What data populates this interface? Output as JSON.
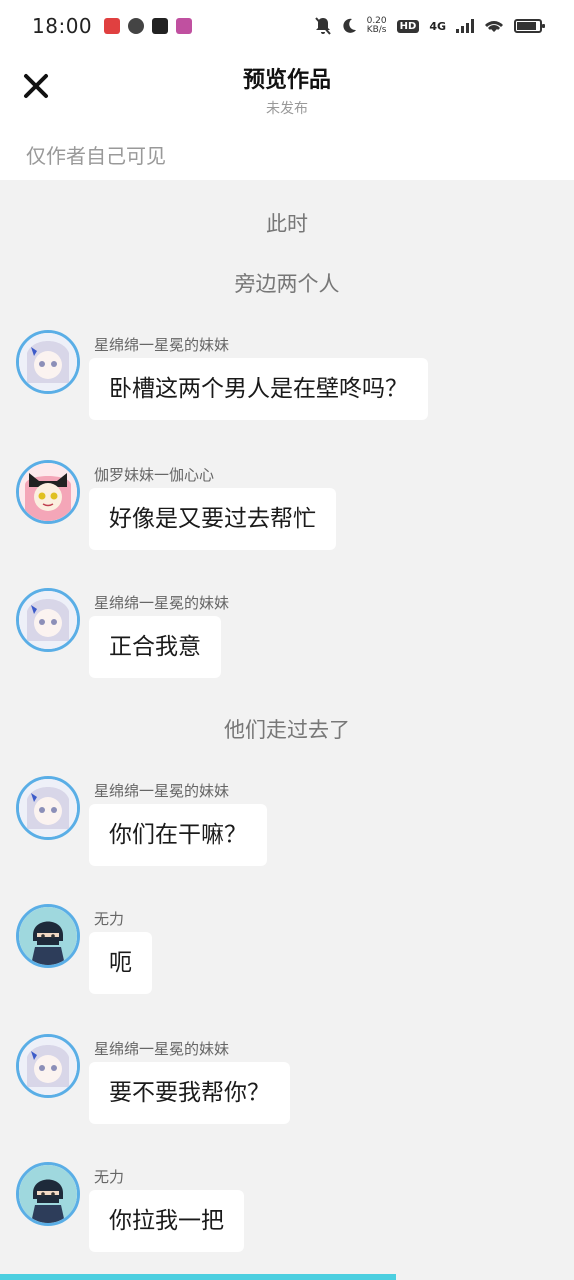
{
  "status_bar": {
    "time": "18:00",
    "net_speed_value": "0.20",
    "net_speed_unit": "KB/s",
    "hd": "HD",
    "network": "4G"
  },
  "header": {
    "title": "预览作品",
    "subtitle": "未发布",
    "visibility_note": "仅作者自己可见"
  },
  "feed": {
    "narration_1": "此时",
    "narration_2": "旁边两个人",
    "narration_3": "他们走过去了",
    "messages": [
      {
        "sender": "星绵绵一星冕的妹妹",
        "text": "卧槽这两个男人是在壁咚吗？",
        "avatar": "white-hair-girl-avatar"
      },
      {
        "sender": "伽罗妹妹一伽心心",
        "text": "好像是又要过去帮忙",
        "avatar": "cat-ear-girl-avatar"
      },
      {
        "sender": "星绵绵一星冕的妹妹",
        "text": "正合我意",
        "avatar": "white-hair-girl-avatar"
      },
      {
        "sender": "星绵绵一星冕的妹妹",
        "text": "你们在干嘛？",
        "avatar": "white-hair-girl-avatar"
      },
      {
        "sender": "无力",
        "text": "呃",
        "avatar": "masked-boy-avatar"
      },
      {
        "sender": "星绵绵一星冕的妹妹",
        "text": "要不要我帮你？",
        "avatar": "white-hair-girl-avatar"
      },
      {
        "sender": "无力",
        "text": "你拉我一把",
        "avatar": "masked-boy-avatar"
      }
    ]
  },
  "progress": {
    "fraction": 0.69
  },
  "colors": {
    "accent": "#4ccfe0",
    "avatar_ring": "#5aaee6",
    "background": "#f2f2f2"
  }
}
